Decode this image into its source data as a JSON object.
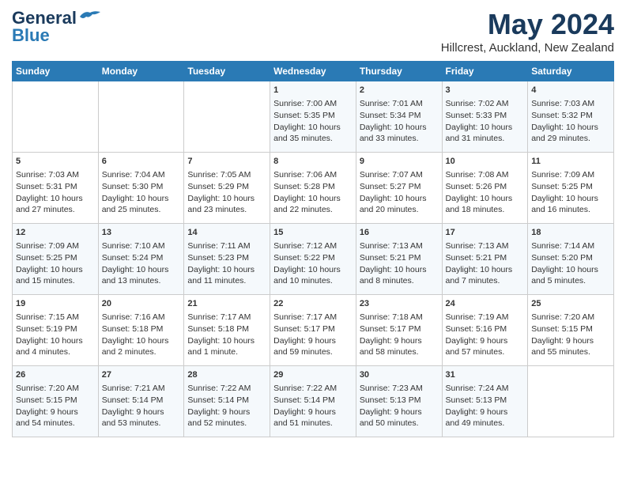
{
  "header": {
    "logo_general": "General",
    "logo_blue": "Blue",
    "month": "May 2024",
    "location": "Hillcrest, Auckland, New Zealand"
  },
  "days_of_week": [
    "Sunday",
    "Monday",
    "Tuesday",
    "Wednesday",
    "Thursday",
    "Friday",
    "Saturday"
  ],
  "weeks": [
    [
      {
        "day": "",
        "content": ""
      },
      {
        "day": "",
        "content": ""
      },
      {
        "day": "",
        "content": ""
      },
      {
        "day": "1",
        "content": "Sunrise: 7:00 AM\nSunset: 5:35 PM\nDaylight: 10 hours\nand 35 minutes."
      },
      {
        "day": "2",
        "content": "Sunrise: 7:01 AM\nSunset: 5:34 PM\nDaylight: 10 hours\nand 33 minutes."
      },
      {
        "day": "3",
        "content": "Sunrise: 7:02 AM\nSunset: 5:33 PM\nDaylight: 10 hours\nand 31 minutes."
      },
      {
        "day": "4",
        "content": "Sunrise: 7:03 AM\nSunset: 5:32 PM\nDaylight: 10 hours\nand 29 minutes."
      }
    ],
    [
      {
        "day": "5",
        "content": "Sunrise: 7:03 AM\nSunset: 5:31 PM\nDaylight: 10 hours\nand 27 minutes."
      },
      {
        "day": "6",
        "content": "Sunrise: 7:04 AM\nSunset: 5:30 PM\nDaylight: 10 hours\nand 25 minutes."
      },
      {
        "day": "7",
        "content": "Sunrise: 7:05 AM\nSunset: 5:29 PM\nDaylight: 10 hours\nand 23 minutes."
      },
      {
        "day": "8",
        "content": "Sunrise: 7:06 AM\nSunset: 5:28 PM\nDaylight: 10 hours\nand 22 minutes."
      },
      {
        "day": "9",
        "content": "Sunrise: 7:07 AM\nSunset: 5:27 PM\nDaylight: 10 hours\nand 20 minutes."
      },
      {
        "day": "10",
        "content": "Sunrise: 7:08 AM\nSunset: 5:26 PM\nDaylight: 10 hours\nand 18 minutes."
      },
      {
        "day": "11",
        "content": "Sunrise: 7:09 AM\nSunset: 5:25 PM\nDaylight: 10 hours\nand 16 minutes."
      }
    ],
    [
      {
        "day": "12",
        "content": "Sunrise: 7:09 AM\nSunset: 5:25 PM\nDaylight: 10 hours\nand 15 minutes."
      },
      {
        "day": "13",
        "content": "Sunrise: 7:10 AM\nSunset: 5:24 PM\nDaylight: 10 hours\nand 13 minutes."
      },
      {
        "day": "14",
        "content": "Sunrise: 7:11 AM\nSunset: 5:23 PM\nDaylight: 10 hours\nand 11 minutes."
      },
      {
        "day": "15",
        "content": "Sunrise: 7:12 AM\nSunset: 5:22 PM\nDaylight: 10 hours\nand 10 minutes."
      },
      {
        "day": "16",
        "content": "Sunrise: 7:13 AM\nSunset: 5:21 PM\nDaylight: 10 hours\nand 8 minutes."
      },
      {
        "day": "17",
        "content": "Sunrise: 7:13 AM\nSunset: 5:21 PM\nDaylight: 10 hours\nand 7 minutes."
      },
      {
        "day": "18",
        "content": "Sunrise: 7:14 AM\nSunset: 5:20 PM\nDaylight: 10 hours\nand 5 minutes."
      }
    ],
    [
      {
        "day": "19",
        "content": "Sunrise: 7:15 AM\nSunset: 5:19 PM\nDaylight: 10 hours\nand 4 minutes."
      },
      {
        "day": "20",
        "content": "Sunrise: 7:16 AM\nSunset: 5:18 PM\nDaylight: 10 hours\nand 2 minutes."
      },
      {
        "day": "21",
        "content": "Sunrise: 7:17 AM\nSunset: 5:18 PM\nDaylight: 10 hours\nand 1 minute."
      },
      {
        "day": "22",
        "content": "Sunrise: 7:17 AM\nSunset: 5:17 PM\nDaylight: 9 hours\nand 59 minutes."
      },
      {
        "day": "23",
        "content": "Sunrise: 7:18 AM\nSunset: 5:17 PM\nDaylight: 9 hours\nand 58 minutes."
      },
      {
        "day": "24",
        "content": "Sunrise: 7:19 AM\nSunset: 5:16 PM\nDaylight: 9 hours\nand 57 minutes."
      },
      {
        "day": "25",
        "content": "Sunrise: 7:20 AM\nSunset: 5:15 PM\nDaylight: 9 hours\nand 55 minutes."
      }
    ],
    [
      {
        "day": "26",
        "content": "Sunrise: 7:20 AM\nSunset: 5:15 PM\nDaylight: 9 hours\nand 54 minutes."
      },
      {
        "day": "27",
        "content": "Sunrise: 7:21 AM\nSunset: 5:14 PM\nDaylight: 9 hours\nand 53 minutes."
      },
      {
        "day": "28",
        "content": "Sunrise: 7:22 AM\nSunset: 5:14 PM\nDaylight: 9 hours\nand 52 minutes."
      },
      {
        "day": "29",
        "content": "Sunrise: 7:22 AM\nSunset: 5:14 PM\nDaylight: 9 hours\nand 51 minutes."
      },
      {
        "day": "30",
        "content": "Sunrise: 7:23 AM\nSunset: 5:13 PM\nDaylight: 9 hours\nand 50 minutes."
      },
      {
        "day": "31",
        "content": "Sunrise: 7:24 AM\nSunset: 5:13 PM\nDaylight: 9 hours\nand 49 minutes."
      },
      {
        "day": "",
        "content": ""
      }
    ]
  ]
}
